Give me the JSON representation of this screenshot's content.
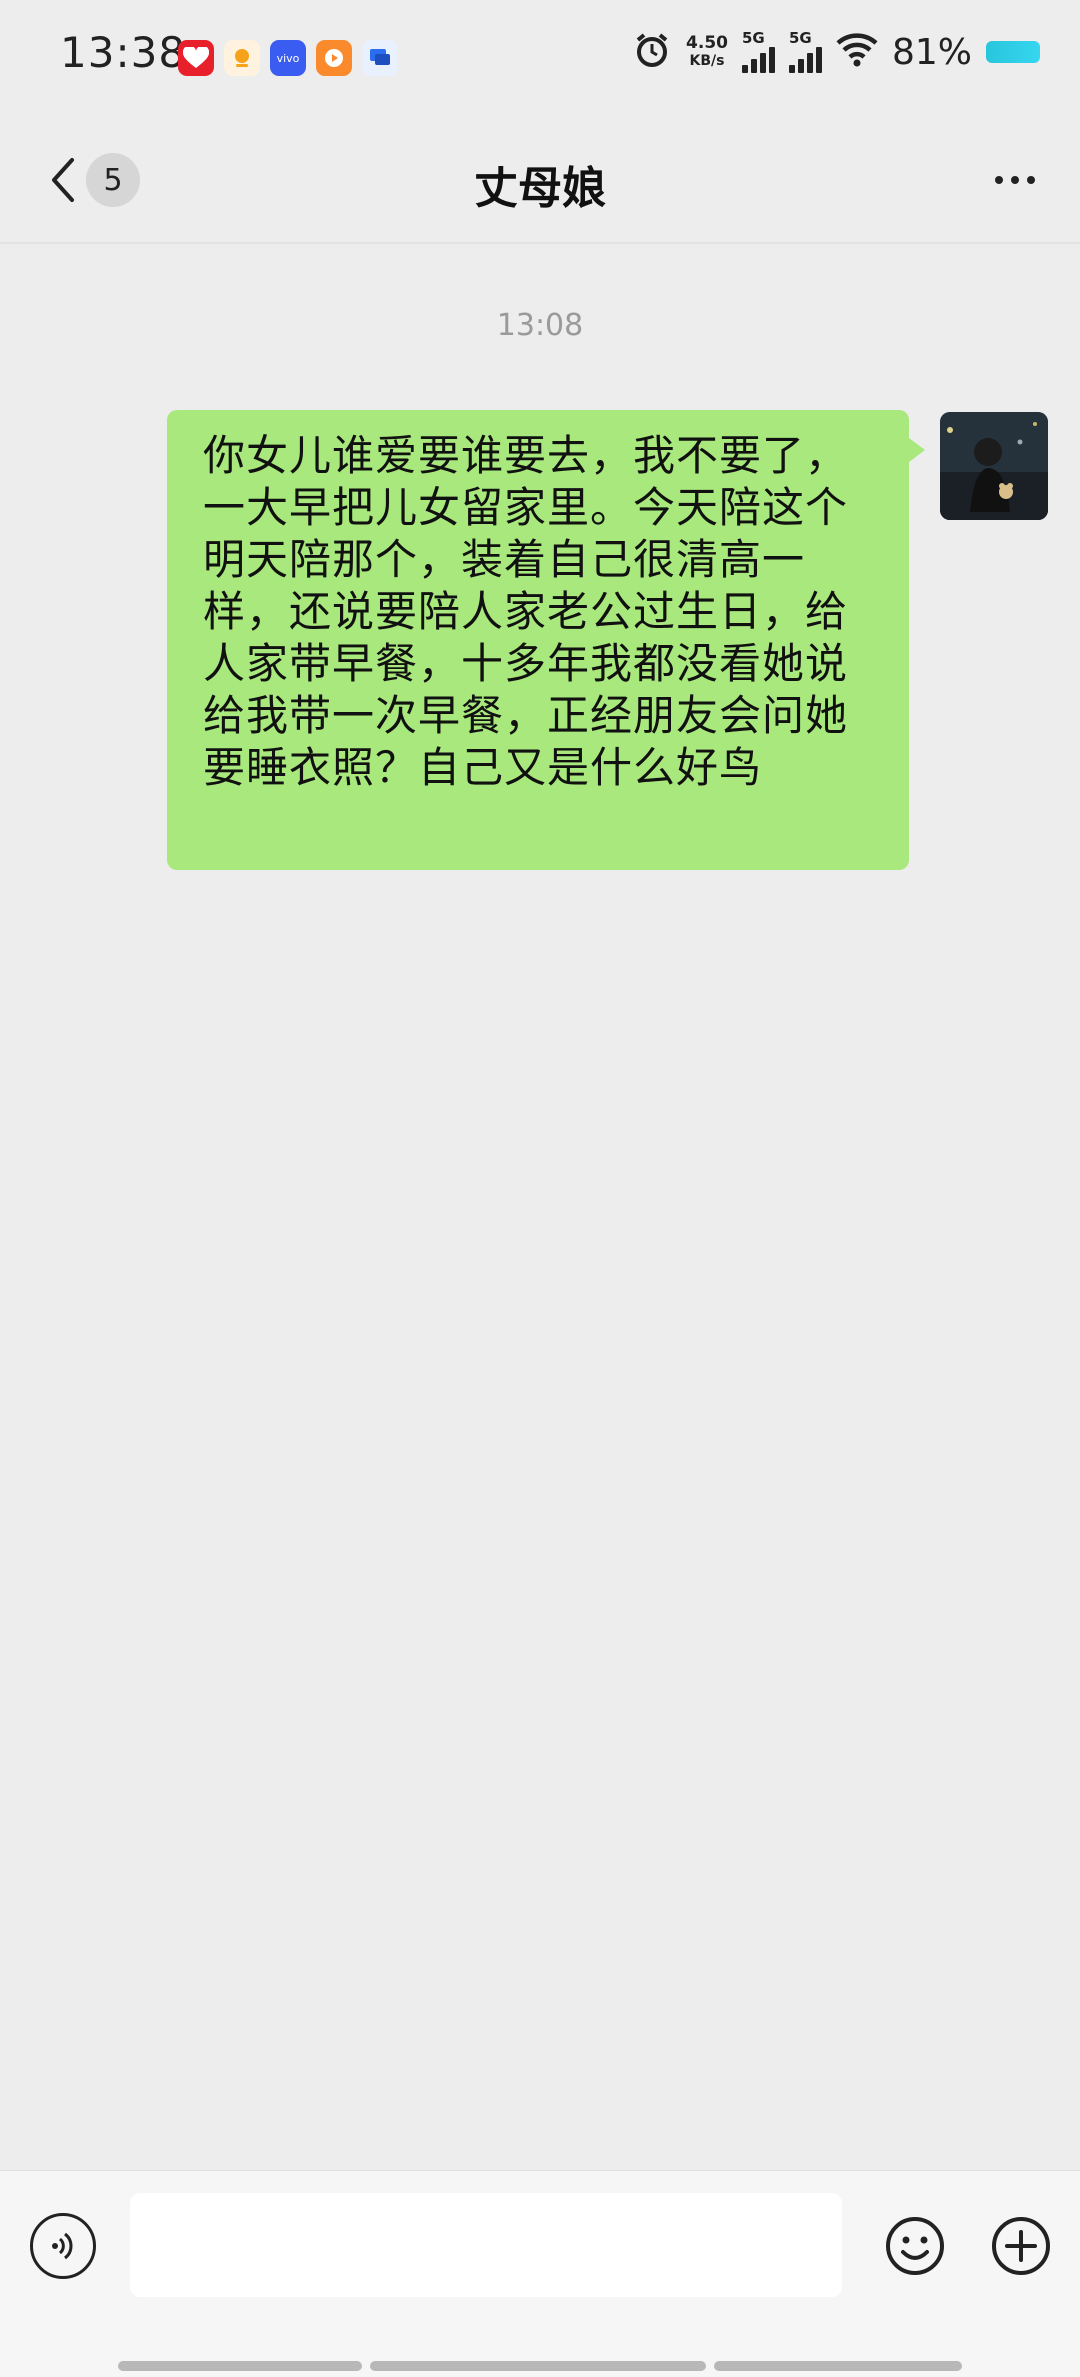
{
  "status_bar": {
    "time": "13:38",
    "net_speed_value": "4.50",
    "net_speed_unit": "KB/s",
    "sim1_label": "5G",
    "sim2_label": "5G",
    "battery": "81%",
    "notification_icons": [
      "app-icon-red",
      "app-icon-orange",
      "vivo-icon",
      "video-app-icon",
      "message-app-icon"
    ],
    "vivo_text": "vivo"
  },
  "header": {
    "unread_count": "5",
    "title": "丈母娘"
  },
  "chat": {
    "timestamp": "13:08",
    "messages": [
      {
        "sender": "self",
        "text": "你女儿谁爱要谁要去，我不要了，一大早把儿女留家里。今天陪这个明天陪那个，装着自己很清高一样，还说要陪人家老公过生日，给人家带早餐，十多年我都没看她说给我带一次早餐，正经朋友会问她要睡衣照？自己又是什么好鸟"
      }
    ]
  },
  "input_bar": {
    "text_value": "",
    "icons": [
      "voice-icon",
      "emoji-icon",
      "plus-icon"
    ]
  }
}
